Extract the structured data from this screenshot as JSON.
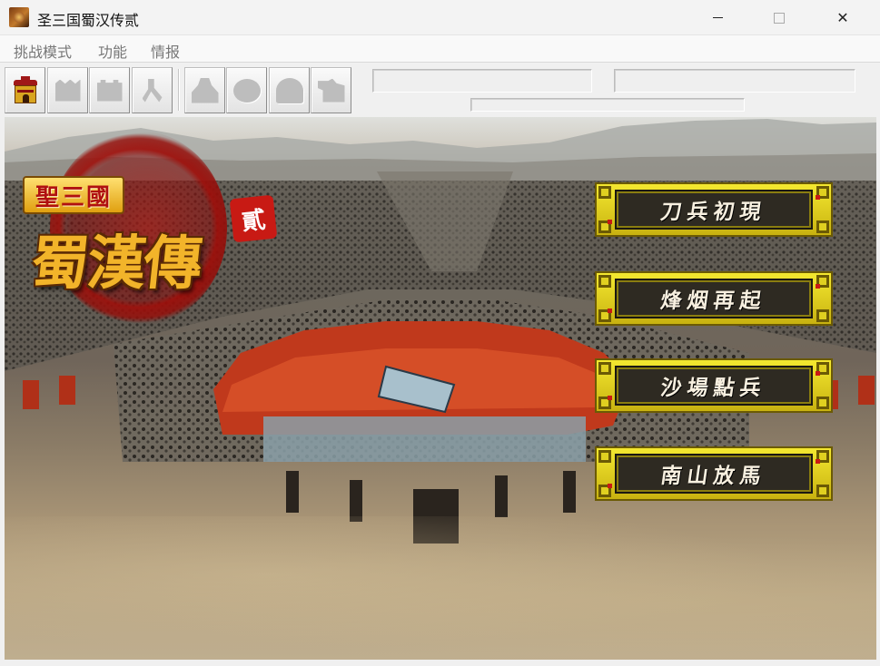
{
  "window": {
    "title": "圣三国蜀汉传贰",
    "minimize_icon": "minimize-icon",
    "maximize_icon": "maximize-icon",
    "close_icon": "close-icon",
    "close_glyph": "✕"
  },
  "menubar": {
    "items": [
      "挑战模式",
      "功能",
      "情报"
    ]
  },
  "toolbar": {
    "buttons": [
      {
        "icon": "castle-icon",
        "enabled": true
      },
      {
        "icon": "fortress-icon",
        "enabled": false
      },
      {
        "icon": "city-wall-icon",
        "enabled": false
      },
      {
        "icon": "hammer-icon",
        "enabled": false
      },
      {
        "icon": "general-icon",
        "enabled": false
      },
      {
        "icon": "shield-icon",
        "enabled": false
      },
      {
        "icon": "helmet-icon",
        "enabled": false
      },
      {
        "icon": "horse-icon",
        "enabled": false
      }
    ]
  },
  "game": {
    "logo": {
      "series": "聖三國",
      "main": "蜀漢傳",
      "number": "貳"
    },
    "menu": [
      {
        "label": "刀兵初現"
      },
      {
        "label": "烽烟再起"
      },
      {
        "label": "沙場點兵"
      },
      {
        "label": "南山放馬"
      }
    ],
    "colors": {
      "button_gold": "#e8d820",
      "button_inner": "#2e2a22",
      "logo_red": "#c81a14",
      "logo_gold": "#f2b42a"
    }
  }
}
